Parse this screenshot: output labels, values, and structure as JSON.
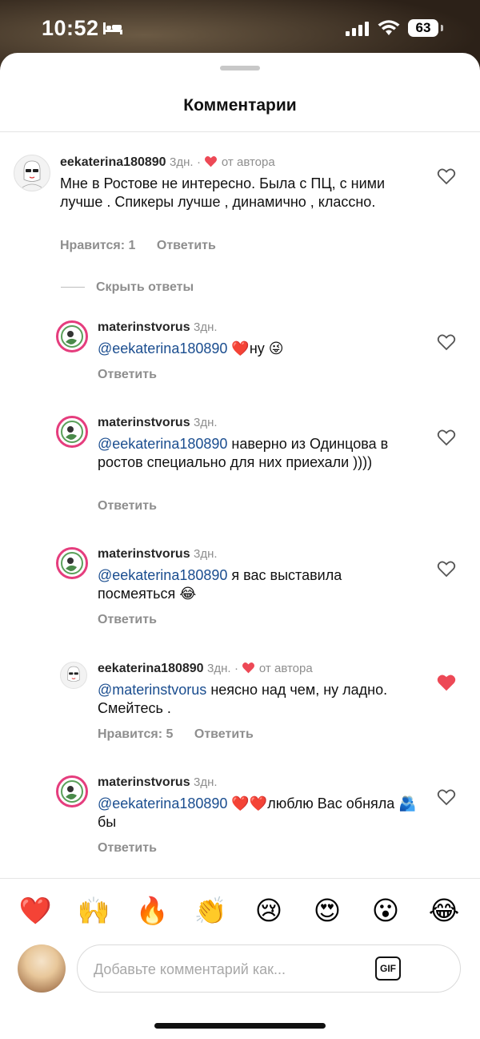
{
  "status_bar": {
    "time": "10:52",
    "battery": "63"
  },
  "header": {
    "title": "Комментарии"
  },
  "comments": [
    {
      "username": "eekaterina180890",
      "age": "3дн.",
      "author_liked": "от автора",
      "mention": "",
      "text": "Мне в Ростове не интересно. Была с ПЦ, с ними лучше . Спикеры лучше , динамично , классно.",
      "likes": "Нравится: 1",
      "reply": "Ответить",
      "liked": false
    }
  ],
  "hide_replies": "Скрыть ответы",
  "replies": [
    {
      "username": "materinstvorus",
      "age": "3дн.",
      "mention": "@eekaterina180890",
      "text": "❤️ну 😜",
      "reply": "Ответить",
      "liked": false
    },
    {
      "username": "materinstvorus",
      "age": "3дн.",
      "mention": "@eekaterina180890",
      "text": "наверно из Одинцова в ростов специально для них приехали ))))",
      "reply": "Ответить",
      "liked": false
    },
    {
      "username": "materinstvorus",
      "age": "3дн.",
      "mention": "@eekaterina180890",
      "text": "я вас выставила посмеяться 😂",
      "reply": "Ответить",
      "liked": false
    },
    {
      "username": "eekaterina180890",
      "age": "3дн.",
      "author_liked": "от автора",
      "mention": "@materinstvorus",
      "text": "неясно над чем, ну ладно. Смейтесь .",
      "likes": "Нравится: 5",
      "reply": "Ответить",
      "liked": true
    },
    {
      "username": "materinstvorus",
      "age": "3дн.",
      "mention": "@eekaterina180890",
      "text": "❤️❤️люблю Вас обняла 🫂 бы",
      "reply": "Ответить",
      "liked": false
    }
  ],
  "reactions": [
    "❤️",
    "🙌",
    "🔥",
    "👏",
    "😢",
    "😍",
    "😮",
    "😂"
  ],
  "composer": {
    "placeholder": "Добавьте комментарий как...",
    "gif_label": "GIF"
  },
  "colors": {
    "like_red": "#ed4956",
    "mention_blue": "#1a4d8f",
    "muted_gray": "#8e8e8e"
  }
}
